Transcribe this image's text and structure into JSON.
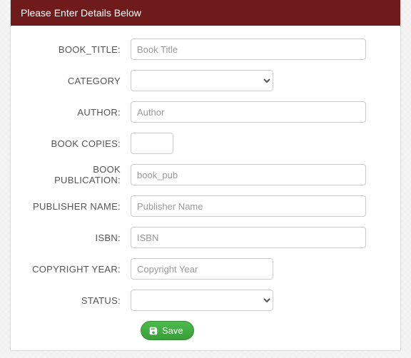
{
  "header": {
    "title": "Please Enter Details Below"
  },
  "form": {
    "book_title": {
      "label": "BOOK_TITLE:",
      "placeholder": "Book Title",
      "value": ""
    },
    "category": {
      "label": "CATEGORY",
      "value": ""
    },
    "author": {
      "label": "AUTHOR:",
      "placeholder": "Author",
      "value": ""
    },
    "book_copies": {
      "label": "BOOK COPIES:",
      "value": ""
    },
    "book_pub": {
      "label": "BOOK PUBLICATION:",
      "placeholder": "book_pub",
      "value": ""
    },
    "publisher": {
      "label": "PUBLISHER NAME:",
      "placeholder": "Publisher Name",
      "value": ""
    },
    "isbn": {
      "label": "ISBN:",
      "placeholder": "ISBN",
      "value": ""
    },
    "copyright": {
      "label": "COPYRIGHT YEAR:",
      "placeholder": "Copyright Year",
      "value": ""
    },
    "status": {
      "label": "STATUS:",
      "value": ""
    }
  },
  "buttons": {
    "save": "Save"
  }
}
